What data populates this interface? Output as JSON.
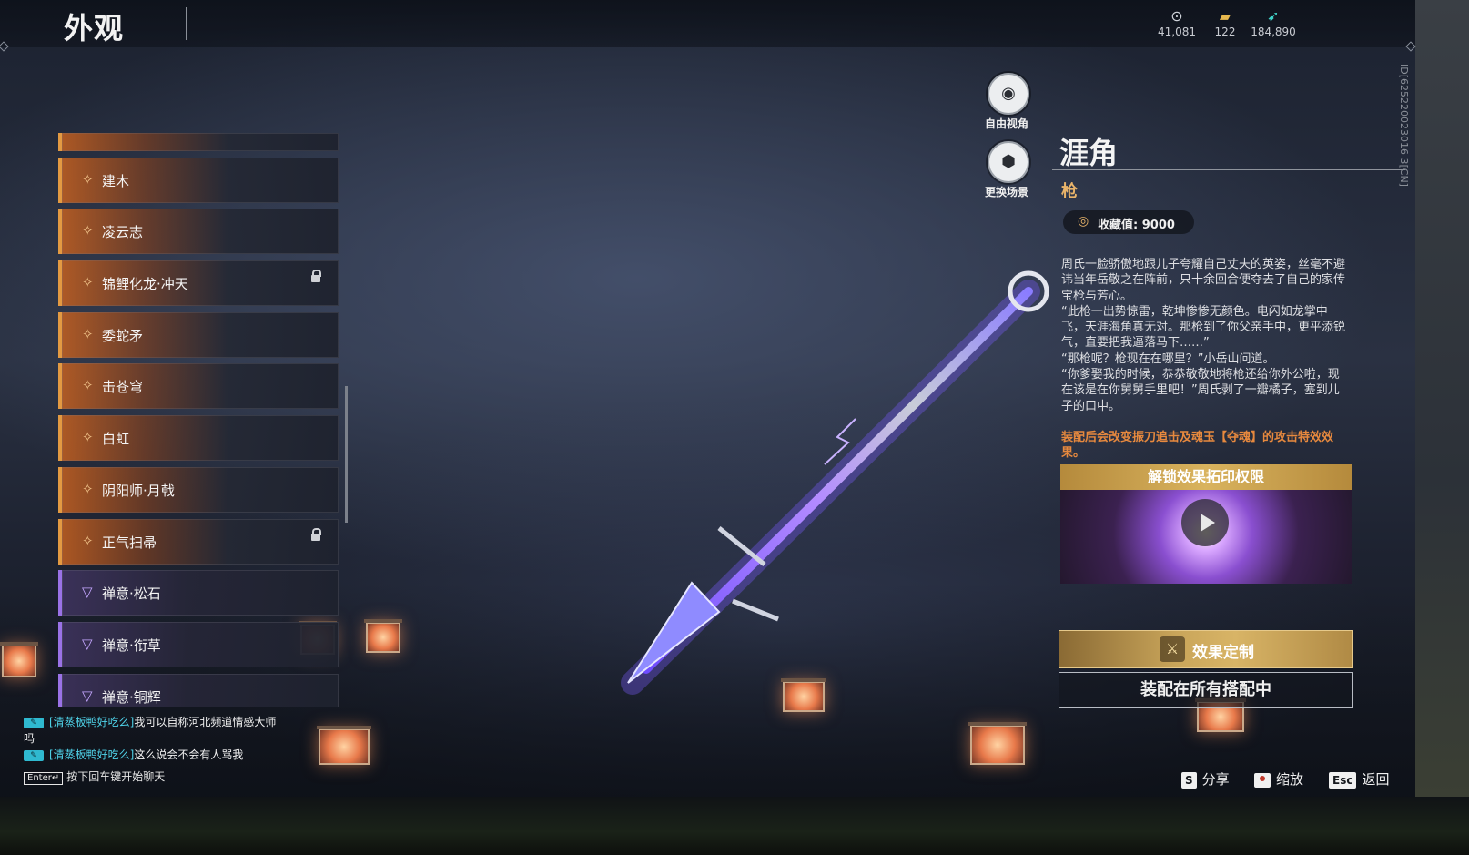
{
  "header": {
    "title": "外观",
    "currencies": [
      {
        "icon": "eye-coin-icon",
        "value": "41,081"
      },
      {
        "icon": "gold-ticket-icon",
        "value": "122"
      },
      {
        "icon": "feather-token-icon",
        "value": "184,890"
      }
    ]
  },
  "camera": {
    "free_view_label": "自由视角",
    "change_scene_label": "更换场景"
  },
  "skin_list": {
    "items": [
      {
        "name": "建木",
        "color": "orange",
        "locked": false
      },
      {
        "name": "凌云志",
        "color": "orange",
        "locked": false
      },
      {
        "name": "锦鲤化龙·冲天",
        "color": "orange",
        "locked": true
      },
      {
        "name": "委蛇矛",
        "color": "orange",
        "locked": false
      },
      {
        "name": "击苍穹",
        "color": "orange",
        "locked": false
      },
      {
        "name": "白虹",
        "color": "orange",
        "locked": false
      },
      {
        "name": "阴阳师·月戟",
        "color": "orange",
        "locked": false
      },
      {
        "name": "正气扫帚",
        "color": "orange",
        "locked": true
      },
      {
        "name": "禅意·松石",
        "color": "purple",
        "locked": false
      },
      {
        "name": "禅意·衔草",
        "color": "purple",
        "locked": false
      },
      {
        "name": "禅意·铜辉",
        "color": "purple",
        "locked": false
      }
    ],
    "accent_orange": "#e39a42",
    "accent_purple": "#9a72e6"
  },
  "detail": {
    "name": "涯角",
    "type": "枪",
    "collection_label": "收藏值: 9000",
    "description": "周氏一脸骄傲地跟儿子夸耀自己丈夫的英姿，丝毫不避讳当年岳敬之在阵前，只十余回合便夺去了自己的家传宝枪与芳心。\n“此枪一出势惊雷，乾坤惨惨无颜色。电闪如龙掌中飞，天涯海角真无对。那枪到了你父亲手中，更平添锐气，直要把我逼落马下……”\n“那枪呢？枪现在在哪里？”小岳山问道。\n“你爹娶我的时候，恭恭敬敬地将枪还给你外公啦，现在该是在你舅舅手里吧！”周氏剥了一瓣橘子，塞到儿子的口中。",
    "effect_note": "装配后会改变振刀追击及魂玉【夺魂】的攻击特效效果。",
    "unlock_header": "解锁效果拓印权限",
    "custom_button": "效果定制",
    "equip_button": "装配在所有搭配中",
    "id_text": "ID[625220023016 3[CN]"
  },
  "chat": {
    "messages": [
      {
        "sender": "[清蒸板鸭好吃么]",
        "text": "我可以自称河北频道情感大师吗"
      },
      {
        "sender": "[清蒸板鸭好吃么]",
        "text": "这么说会不会有人骂我"
      }
    ],
    "enter_key": "Enter↵",
    "hint": "按下回车键开始聊天"
  },
  "hotkeys": [
    {
      "key": "S",
      "label": "分享"
    },
    {
      "key": "",
      "icon": "zoom-key-icon",
      "label": "缩放"
    },
    {
      "key": "Esc",
      "label": "返回"
    }
  ]
}
